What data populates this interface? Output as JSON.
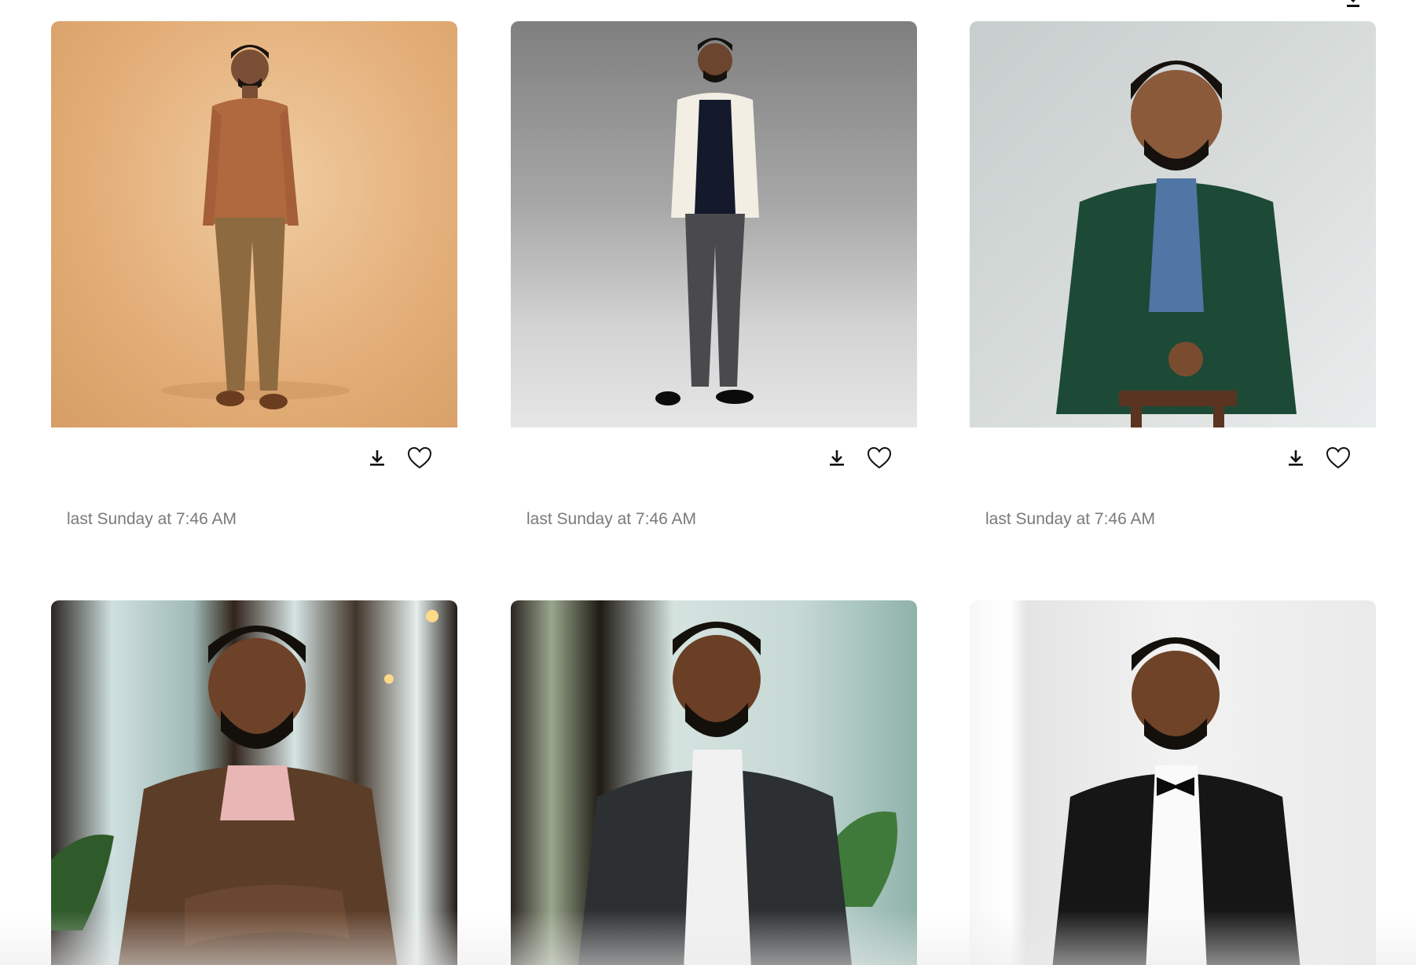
{
  "gallery": {
    "cards": [
      {
        "timestamp": "last Sunday at 7:46 AM",
        "photo": "person-standing-brown-sweater"
      },
      {
        "timestamp": "last Sunday at 7:46 AM",
        "photo": "person-standing-white-blazer"
      },
      {
        "timestamp": "last Sunday at 7:46 AM",
        "photo": "person-seated-green-suit"
      },
      {
        "photo": "person-arms-crossed-office"
      },
      {
        "photo": "person-seated-dark-suit"
      },
      {
        "photo": "person-seated-tuxedo"
      }
    ],
    "icons": {
      "download": "download-icon",
      "favorite": "heart-icon"
    }
  }
}
